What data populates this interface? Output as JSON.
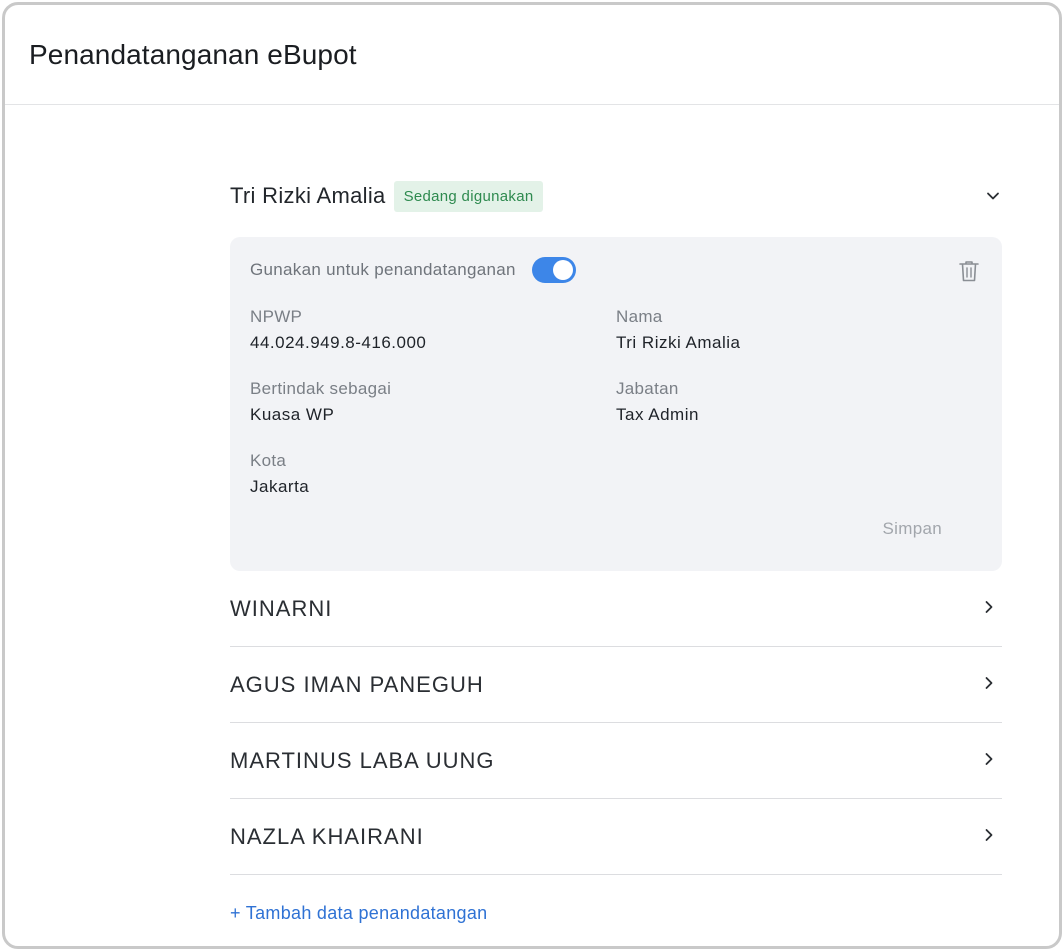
{
  "header": {
    "title": "Penandatanganan eBupot"
  },
  "active_signer": {
    "name": "Tri Rizki Amalia",
    "badge": "Sedang digunakan",
    "use_label": "Gunakan untuk penandatanganan",
    "toggle_on": true,
    "fields": [
      {
        "label": "NPWP",
        "value": "44.024.949.8-416.000"
      },
      {
        "label": "Nama",
        "value": "Tri Rizki Amalia"
      },
      {
        "label": "Bertindak sebagai",
        "value": "Kuasa WP"
      },
      {
        "label": "Jabatan",
        "value": "Tax Admin"
      },
      {
        "label": "Kota",
        "value": "Jakarta"
      }
    ],
    "save_label": "Simpan"
  },
  "signers": [
    {
      "name": "WINARNI"
    },
    {
      "name": "AGUS IMAN PANEGUH"
    },
    {
      "name": "MARTINUS LABA UUNG"
    },
    {
      "name": "NAZLA KHAIRANI"
    }
  ],
  "add_label": "+ Tambah data penandatangan",
  "colors": {
    "accent": "#3d86e8",
    "badge_bg": "#e3f2e8",
    "badge_text": "#2e8a4f",
    "link": "#2f72d4"
  },
  "icons": {
    "collapse": "chevron-down-icon",
    "expand": "chevron-right-icon",
    "delete": "trash-icon"
  }
}
